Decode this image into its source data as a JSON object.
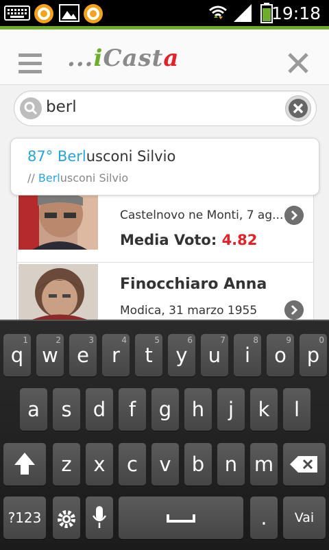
{
  "status_bar": {
    "time": "19:18"
  },
  "header": {
    "logo": {
      "dots": "...",
      "i": "i",
      "cast": "Cast",
      "a": "a"
    }
  },
  "search": {
    "value": "berl"
  },
  "suggestion": {
    "rank": "87°",
    "title_highlight": "Berl",
    "title_rest": "usconi Silvio",
    "sub_prefix": "//",
    "sub_highlight": "Berl",
    "sub_rest": "usconi Silvio"
  },
  "results": [
    {
      "place": "Castelnovo ne Monti, 7 ag...",
      "vote_label": "Media Voto:",
      "vote_value": "4.82"
    },
    {
      "name": "Finocchiaro Anna",
      "place": "Modica, 31 marzo 1955"
    }
  ],
  "keyboard": {
    "row1": [
      [
        "q",
        "1"
      ],
      [
        "w",
        "2"
      ],
      [
        "e",
        "3"
      ],
      [
        "r",
        "4"
      ],
      [
        "t",
        "5"
      ],
      [
        "y",
        "6"
      ],
      [
        "u",
        "7"
      ],
      [
        "i",
        "8"
      ],
      [
        "o",
        "9"
      ],
      [
        "p",
        "0"
      ]
    ],
    "row2": [
      "a",
      "s",
      "d",
      "f",
      "g",
      "h",
      "j",
      "k",
      "l"
    ],
    "row3": [
      "z",
      "x",
      "c",
      "v",
      "b",
      "n",
      "m"
    ],
    "symbols_label": "?123",
    "dot_label": ".",
    "go_label": "Vai"
  },
  "colors": {
    "accent_green": "#6cae2a",
    "accent_red": "#e32228",
    "highlight_blue": "#2aa3d8"
  }
}
